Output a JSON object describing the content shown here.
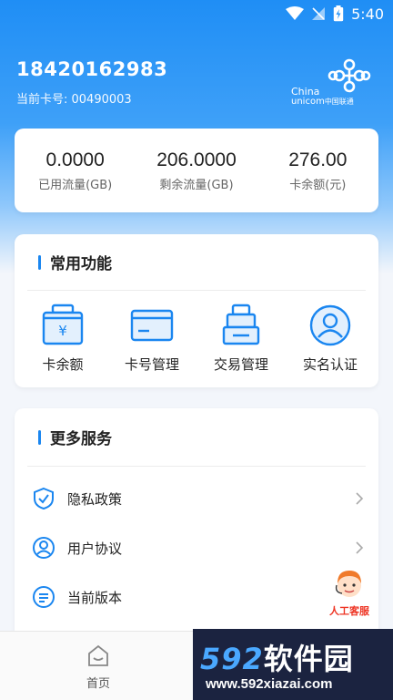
{
  "status_bar": {
    "time": "5:40",
    "icons": [
      "wifi-icon",
      "signal-off-icon",
      "battery-charging-icon"
    ]
  },
  "account": {
    "phone": "18420162983",
    "card_no": "当前卡号: 00490003"
  },
  "logo": {
    "cn": "China",
    "en": "unicom",
    "en_cn": "中国联通"
  },
  "stats": [
    {
      "value": "0.0000",
      "label": "已用流量(GB)"
    },
    {
      "value": "206.0000",
      "label": "剩余流量(GB)"
    },
    {
      "value": "276.00",
      "label": "卡余额(元)"
    }
  ],
  "common_functions": {
    "title": "常用功能",
    "items": [
      {
        "label": "卡余额",
        "icon": "wallet-yen-icon"
      },
      {
        "label": "卡号管理",
        "icon": "card-icon"
      },
      {
        "label": "交易管理",
        "icon": "transaction-icon"
      },
      {
        "label": "实名认证",
        "icon": "user-verify-icon"
      }
    ]
  },
  "more_services": {
    "title": "更多服务",
    "items": [
      {
        "label": "隐私政策",
        "icon": "shield-check-icon"
      },
      {
        "label": "用户协议",
        "icon": "user-circle-icon"
      },
      {
        "label": "当前版本",
        "icon": "message-lines-icon"
      }
    ]
  },
  "customer_service": {
    "label": "人工客服"
  },
  "bottom_nav": {
    "home": "首页"
  },
  "watermark": {
    "brand_num": "592",
    "brand_cn": "软件园",
    "url": "www.592xiazai.com"
  },
  "colors": {
    "accent": "#1a86f0",
    "header_gradient_top": "#1f8ef5",
    "text": "#222222"
  }
}
